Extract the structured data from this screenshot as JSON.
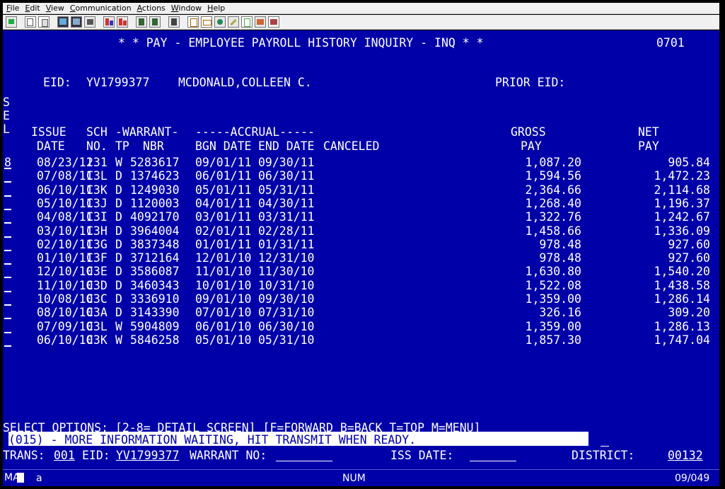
{
  "menu": [
    "File",
    "Edit",
    "View",
    "Communication",
    "Actions",
    "Window",
    "Help"
  ],
  "toolbar_icons": [
    "display-icon",
    "copy-icon",
    "paste-icon",
    "send-icon",
    "receive-icon",
    "record-icon",
    "print-icon",
    "print-screen-icon",
    "transfer-up-icon",
    "transfer-down-icon",
    "clipboard-icon",
    "macro-icon",
    "keyboard-icon",
    "color-icon",
    "edit-icon",
    "doc-icon",
    "palette-icon",
    "help-icon"
  ],
  "header": {
    "title": "* * PAY - EMPLOYEE PAYROLL HISTORY INQUIRY - INQ * *",
    "code": "0701",
    "eid_label": "EID:",
    "eid_value": "YV1799377",
    "name": "MCDONALD,COLLEEN C.",
    "prior_eid_label": "PRIOR EID:",
    "sel": [
      "S",
      "E",
      "L"
    ]
  },
  "columns": {
    "line1": [
      "ISSUE",
      "SCH",
      "-WARRANT-",
      "-----ACCRUAL-----",
      "GROSS",
      "NET"
    ],
    "line2": [
      "DATE",
      "NO.",
      "TP",
      "NBR",
      "BGN DATE",
      "END DATE",
      "CANCELED",
      "PAY",
      "PAY"
    ]
  },
  "rows": [
    {
      "sel": "8",
      "date": "08/23/11",
      "sch": "231",
      "tp": "W",
      "nbr": "5283617",
      "bgn": "09/01/11",
      "end": "09/30/11",
      "gross": "1,087.20",
      "net": "905.84"
    },
    {
      "sel": "",
      "date": "07/08/11",
      "sch": "C3L",
      "tp": "D",
      "nbr": "1374623",
      "bgn": "06/01/11",
      "end": "06/30/11",
      "gross": "1,594.56",
      "net": "1,472.23"
    },
    {
      "sel": "",
      "date": "06/10/11",
      "sch": "C3K",
      "tp": "D",
      "nbr": "1249030",
      "bgn": "05/01/11",
      "end": "05/31/11",
      "gross": "2,364.66",
      "net": "2,114.68"
    },
    {
      "sel": "",
      "date": "05/10/11",
      "sch": "C3J",
      "tp": "D",
      "nbr": "1120003",
      "bgn": "04/01/11",
      "end": "04/30/11",
      "gross": "1,268.40",
      "net": "1,196.37"
    },
    {
      "sel": "",
      "date": "04/08/11",
      "sch": "C3I",
      "tp": "D",
      "nbr": "4092170",
      "bgn": "03/01/11",
      "end": "03/31/11",
      "gross": "1,322.76",
      "net": "1,242.67"
    },
    {
      "sel": "",
      "date": "03/10/11",
      "sch": "C3H",
      "tp": "D",
      "nbr": "3964004",
      "bgn": "02/01/11",
      "end": "02/28/11",
      "gross": "1,458.66",
      "net": "1,336.09"
    },
    {
      "sel": "",
      "date": "02/10/11",
      "sch": "C3G",
      "tp": "D",
      "nbr": "3837348",
      "bgn": "01/01/11",
      "end": "01/31/11",
      "gross": "978.48",
      "net": "927.60"
    },
    {
      "sel": "",
      "date": "01/10/11",
      "sch": "C3F",
      "tp": "D",
      "nbr": "3712164",
      "bgn": "12/01/10",
      "end": "12/31/10",
      "gross": "978.48",
      "net": "927.60"
    },
    {
      "sel": "",
      "date": "12/10/10",
      "sch": "C3E",
      "tp": "D",
      "nbr": "3586087",
      "bgn": "11/01/10",
      "end": "11/30/10",
      "gross": "1,630.80",
      "net": "1,540.20"
    },
    {
      "sel": "",
      "date": "11/10/10",
      "sch": "C3D",
      "tp": "D",
      "nbr": "3460343",
      "bgn": "10/01/10",
      "end": "10/31/10",
      "gross": "1,522.08",
      "net": "1,438.58"
    },
    {
      "sel": "",
      "date": "10/08/10",
      "sch": "C3C",
      "tp": "D",
      "nbr": "3336910",
      "bgn": "09/01/10",
      "end": "09/30/10",
      "gross": "1,359.00",
      "net": "1,286.14"
    },
    {
      "sel": "",
      "date": "08/10/10",
      "sch": "C3A",
      "tp": "D",
      "nbr": "3143390",
      "bgn": "07/01/10",
      "end": "07/31/10",
      "gross": "326.16",
      "net": "309.20"
    },
    {
      "sel": "",
      "date": "07/09/10",
      "sch": "C3L",
      "tp": "W",
      "nbr": "5904809",
      "bgn": "06/01/10",
      "end": "06/30/10",
      "gross": "1,359.00",
      "net": "1,286.13"
    },
    {
      "sel": "",
      "date": "06/10/10",
      "sch": "C3K",
      "tp": "W",
      "nbr": "5846258",
      "bgn": "05/01/10",
      "end": "05/31/10",
      "gross": "1,857.30",
      "net": "1,747.04"
    }
  ],
  "footer": {
    "options": "SELECT OPTIONS: [2-8= DETAIL SCREEN] [F=FORWARD B=BACK T=TOP M=MENU]",
    "message": "(015) - MORE INFORMATION WAITING, HIT TRANSMIT WHEN READY.",
    "trans_label": "TRANS:",
    "trans_value": "001",
    "eid_label": "EID:",
    "eid_value": "YV1799377",
    "warrant_label": "WARRANT NO:",
    "iss_label": "ISS DATE:",
    "district_label": "DISTRICT:",
    "district_value": "00132"
  },
  "statusbar": {
    "mode": "MA",
    "cursor": "a",
    "num": "NUM",
    "position": "09/049"
  },
  "colors": {
    "screen": "#0000a8",
    "text": "#ffffff",
    "highlight": "#ffffff"
  }
}
